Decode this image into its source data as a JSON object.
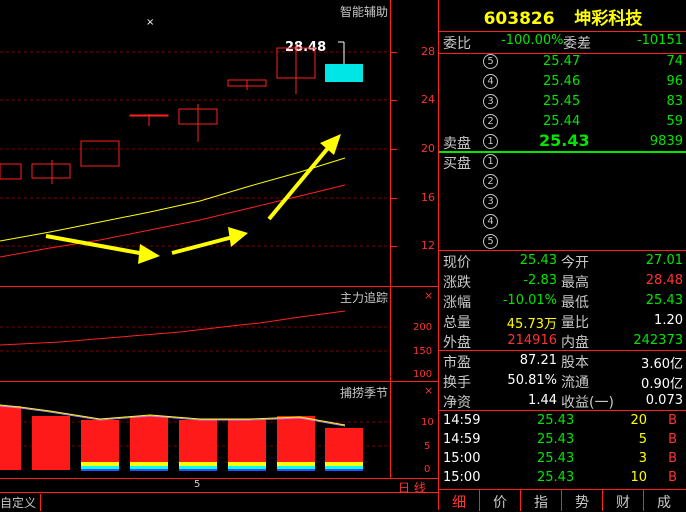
{
  "main_chart": {
    "title": "智能辅助",
    "price_label": "28.48",
    "close_marker": "×",
    "axis_ticks": [
      "28",
      "24",
      "20",
      "16",
      "12"
    ],
    "bottom_tick": "5"
  },
  "sub1": {
    "title": "主力追踪",
    "ticks": [
      "200",
      "150",
      "100"
    ],
    "close": "×"
  },
  "sub2": {
    "title": "捕捞季节",
    "ticks": [
      "10",
      "5",
      "0"
    ],
    "close": "×"
  },
  "bottom_bar": {
    "custom_label": "自定义",
    "period_label": "日 线"
  },
  "quote": {
    "code": "603826",
    "name": "坤彩科技",
    "weibi_label": "委比",
    "weibi_value": "-100.00%",
    "weicha_label": "委差",
    "weicha_value": "-10151",
    "sell_label": "卖盘",
    "buy_label": "买盘",
    "asks": [
      {
        "idx": "5",
        "price": "25.47",
        "vol": "74"
      },
      {
        "idx": "4",
        "price": "25.46",
        "vol": "96"
      },
      {
        "idx": "3",
        "price": "25.45",
        "vol": "83"
      },
      {
        "idx": "2",
        "price": "25.44",
        "vol": "59"
      },
      {
        "idx": "1",
        "price": "25.43",
        "vol": "9839"
      }
    ],
    "bids": [
      "1",
      "2",
      "3",
      "4",
      "5"
    ],
    "stats": [
      {
        "l1": "现价",
        "v1": "25.43",
        "l2": "今开",
        "v2": "27.01"
      },
      {
        "l1": "涨跌",
        "v1": "-2.83",
        "l2": "最高",
        "v2": "28.48"
      },
      {
        "l1": "涨幅",
        "v1": "-10.01%",
        "l2": "最低",
        "v2": "25.43"
      },
      {
        "l1": "总量",
        "v1": "45.73万",
        "l2": "量比",
        "v2": "1.20"
      },
      {
        "l1": "外盘",
        "v1": "214916",
        "l2": "内盘",
        "v2": "242373"
      },
      {
        "l1": "市盈",
        "v1": "87.21",
        "l2": "股本",
        "v2": "3.60亿"
      },
      {
        "l1": "换手",
        "v1": "50.81%",
        "l2": "流通",
        "v2": "0.90亿"
      },
      {
        "l1": "净资",
        "v1": "1.44",
        "l2": "收益(一)",
        "v2": "0.073"
      }
    ],
    "ticks": [
      {
        "time": "14:59",
        "price": "25.43",
        "vol": "20",
        "side": "B"
      },
      {
        "time": "14:59",
        "price": "25.43",
        "vol": "5",
        "side": "B"
      },
      {
        "time": "15:00",
        "price": "25.43",
        "vol": "3",
        "side": "B"
      },
      {
        "time": "15:00",
        "price": "25.43",
        "vol": "10",
        "side": "B"
      }
    ],
    "tabs": [
      "细",
      "价",
      "指",
      "势",
      "财",
      "成"
    ]
  }
}
